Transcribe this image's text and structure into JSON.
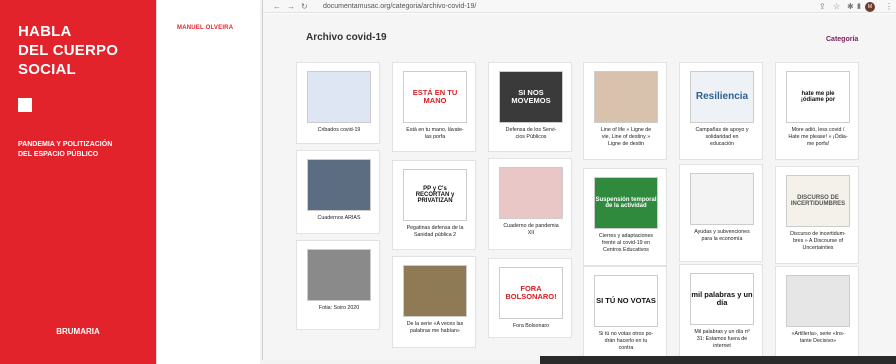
{
  "book": {
    "title": "HABLA\nDEL CUERPO\nSOCIAL",
    "subtitle": "PANDEMIA Y POLITIZACIÓN\nDEL ESPACIO PÚBLICO",
    "publisher": "BRUMARIA",
    "author": "MANUEL OLVEIRA",
    "colors": {
      "cover": "#e3232c"
    }
  },
  "browser": {
    "url": "documentamusac.org/categoria/archivo-covid-19/",
    "avatar_initial": "M",
    "icons": [
      "back-icon",
      "forward-icon",
      "reload-icon",
      "share-icon",
      "star-icon",
      "extension-icon",
      "sidebar-icon",
      "menu-icon"
    ]
  },
  "page": {
    "title": "Archivo covid-19",
    "category_link": "Categoría",
    "accent_color": "#7a1f5c"
  },
  "cards": [
    {
      "caption": "Cribados covid-19",
      "thumb_text": "",
      "thumb_bg": "#dde6f2",
      "thumb_color": "#1f5aa0"
    },
    {
      "caption": "Está en tu mano, lávate-\nlas porfa",
      "thumb_text": "ESTÁ EN TU MANO",
      "thumb_bg": "#ffffff",
      "thumb_color": "#d42026"
    },
    {
      "caption": "Defensa de los Servi-\ncios Públicos",
      "thumb_text": "SI NOS\nMOVEMOS",
      "thumb_bg": "#3a3a3a",
      "thumb_color": "#ffffff"
    },
    {
      "caption": "Line of life » Ligne de\nvie, Line of destiny »\nLigne de destin",
      "thumb_text": "",
      "thumb_bg": "#d8c2ad",
      "thumb_color": "#5a4636"
    },
    {
      "caption": "Campañas de apoyo y\nsolidaridad en\neducación",
      "thumb_text": "Resiliencia",
      "thumb_bg": "#eef2f7",
      "thumb_color": "#2d5f91"
    },
    {
      "caption": "More adió, less covid /\nHate me please! » ¡Ódia-\nme porfa!",
      "thumb_text": "hate me ple\n¡ódiame por",
      "thumb_bg": "#ffffff",
      "thumb_color": "#111111"
    },
    {
      "caption": "Cuadernos ARIAS",
      "thumb_text": "",
      "thumb_bg": "#5c6d82",
      "thumb_color": "#ffffff"
    },
    {
      "caption": "Pegatinas defensa de la\nSanidad pública 2",
      "thumb_text": "PP y C's\nRECORTAN y\nPRIVATIZAN",
      "thumb_bg": "#ffffff",
      "thumb_color": "#111111"
    },
    {
      "caption": "Cuaderno de pandemia\nXII",
      "thumb_text": "",
      "thumb_bg": "#e9c7c7",
      "thumb_color": "#9b3b3b"
    },
    {
      "caption": "Cierres y adaptaciones\nfrente al covid-19 en\nCentros Educativos",
      "thumb_text": "Suspensión temporal\nde la actividad",
      "thumb_bg": "#2f8a3e",
      "thumb_color": "#ffffff"
    },
    {
      "caption": "Ayudas y subvenciones\npara la economía",
      "thumb_text": "",
      "thumb_bg": "#f3f3f3",
      "thumb_color": "#8b1c1c"
    },
    {
      "caption": "Discurso de incertidum-\nbres » A Discourse of\nUncertainties",
      "thumb_text": "DISCURSO DE\nINCERTIDUMBRES",
      "thumb_bg": "#f4f1ea",
      "thumb_color": "#555555"
    },
    {
      "caption": "Fotia: Soiro 2020",
      "thumb_text": "",
      "thumb_bg": "#8a8a8a",
      "thumb_color": "#ffffff"
    },
    {
      "caption": "De la serie «A veces las\npalabras me habían»",
      "thumb_text": "",
      "thumb_bg": "#8e7a55",
      "thumb_color": "#ffffff"
    },
    {
      "caption": "Fora Bolsonaro",
      "thumb_text": "FORA\nBOLSONARO!",
      "thumb_bg": "#ffffff",
      "thumb_color": "#d42026"
    },
    {
      "caption": "Si tú no votas otros po-\ndrán hacerlo en tu\ncontra",
      "thumb_text": "SI TÚ NO VOTAS",
      "thumb_bg": "#ffffff",
      "thumb_color": "#111111"
    },
    {
      "caption": "Mil palabras y un día nº\n31: Estamos fuera de\ninternet",
      "thumb_text": "mil palabras y un día",
      "thumb_bg": "#ffffff",
      "thumb_color": "#111111"
    },
    {
      "caption": "«Artillería», serie «Ins-\ntante Decisivo»",
      "thumb_text": "",
      "thumb_bg": "#e6e6e6",
      "thumb_color": "#333333"
    }
  ]
}
